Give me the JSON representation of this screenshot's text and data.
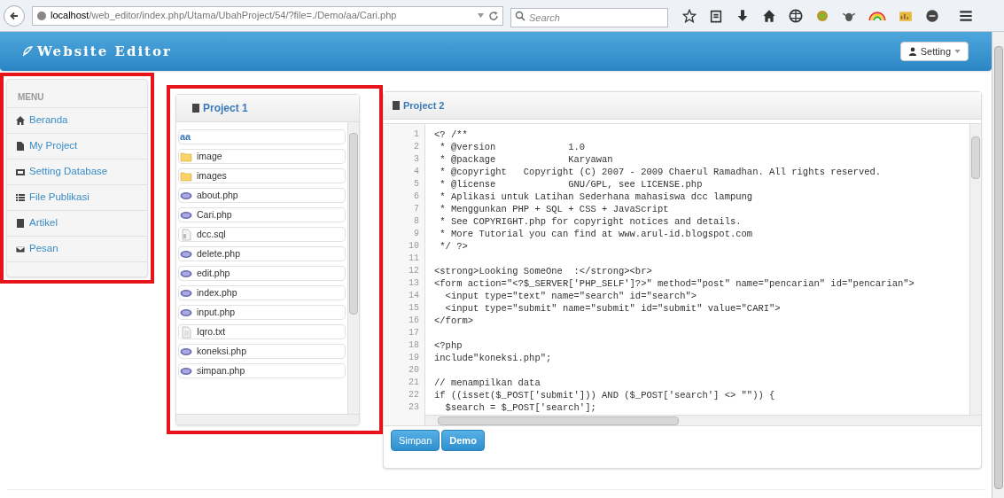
{
  "browser": {
    "url_host": "localhost",
    "url_path": "/web_editor/index.php/Utama/UbahProject/54/?file=./Demo/aa/Cari.php",
    "search_placeholder": "Search"
  },
  "header": {
    "title": "Website Editor",
    "setting_button": "Setting"
  },
  "sidebar": {
    "heading": "MENU",
    "items": [
      {
        "label": "Beranda",
        "kind": "home"
      },
      {
        "label": "My Project",
        "kind": "file"
      },
      {
        "label": "Setting Database",
        "kind": "database"
      },
      {
        "label": "File Publikasi",
        "kind": "list"
      },
      {
        "label": "Artikel",
        "kind": "book"
      },
      {
        "label": "Pesan",
        "kind": "mail"
      }
    ]
  },
  "project1": {
    "title": "Project 1",
    "files": [
      {
        "name": "aa",
        "kind": "current"
      },
      {
        "name": "image",
        "kind": "folder"
      },
      {
        "name": "images",
        "kind": "folder"
      },
      {
        "name": "about.php",
        "kind": "php"
      },
      {
        "name": "Cari.php",
        "kind": "php"
      },
      {
        "name": "dcc.sql",
        "kind": "sql"
      },
      {
        "name": "delete.php",
        "kind": "php"
      },
      {
        "name": "edit.php",
        "kind": "php"
      },
      {
        "name": "index.php",
        "kind": "php"
      },
      {
        "name": "input.php",
        "kind": "php"
      },
      {
        "name": "Iqro.txt",
        "kind": "txt"
      },
      {
        "name": "koneksi.php",
        "kind": "php"
      },
      {
        "name": "simpan.php",
        "kind": "php"
      }
    ]
  },
  "project2": {
    "title": "Project 2",
    "code_lines": [
      {
        "number": "1",
        "text": "<? /**"
      },
      {
        "number": "2",
        "text": " * @version             1.0"
      },
      {
        "number": "3",
        "text": " * @package             Karyawan"
      },
      {
        "number": "4",
        "text": " * @copyright   Copyright (C) 2007 - 2009 Chaerul Ramadhan. All rights reserved."
      },
      {
        "number": "5",
        "text": " * @license             GNU/GPL, see LICENSE.php"
      },
      {
        "number": "6",
        "text": " * Aplikasi untuk Latihan Sederhana mahasiswa dcc lampung"
      },
      {
        "number": "7",
        "text": " * Menggunkan PHP + SQL + CSS + JavaScript"
      },
      {
        "number": "8",
        "text": " * See COPYRIGHT.php for copyright notices and details."
      },
      {
        "number": "9",
        "text": " * More Tutorial you can find at www.arul-id.blogspot.com"
      },
      {
        "number": "10",
        "text": " */ ?>"
      },
      {
        "number": "11"
      },
      {
        "number": "12",
        "text": "<strong>Looking SomeOne  :</strong><br>"
      },
      {
        "number": "13",
        "text": "<form action=\"<?$_SERVER['PHP_SELF']?>\" method=\"post\" name=\"pencarian\" id=\"pencarian\">"
      },
      {
        "number": "14",
        "text": "  <input type=\"text\" name=\"search\" id=\"search\">"
      },
      {
        "number": "15",
        "text": "  <input type=\"submit\" name=\"submit\" id=\"submit\" value=\"CARI\">"
      },
      {
        "number": "16",
        "text": "</form>"
      },
      {
        "number": "17"
      },
      {
        "number": "18",
        "text": "<?php"
      },
      {
        "number": "19",
        "text": "include\"koneksi.php\";"
      },
      {
        "number": "20"
      },
      {
        "number": "21",
        "text": "// menampilkan data"
      },
      {
        "number": "22",
        "text": "if ((isset($_POST['submit'])) AND ($_POST['search'] <> \"\")) {"
      },
      {
        "number": "23",
        "text": "  $search = $_POST['search'];"
      }
    ],
    "buttons": [
      "Simpan",
      "Demo"
    ]
  }
}
